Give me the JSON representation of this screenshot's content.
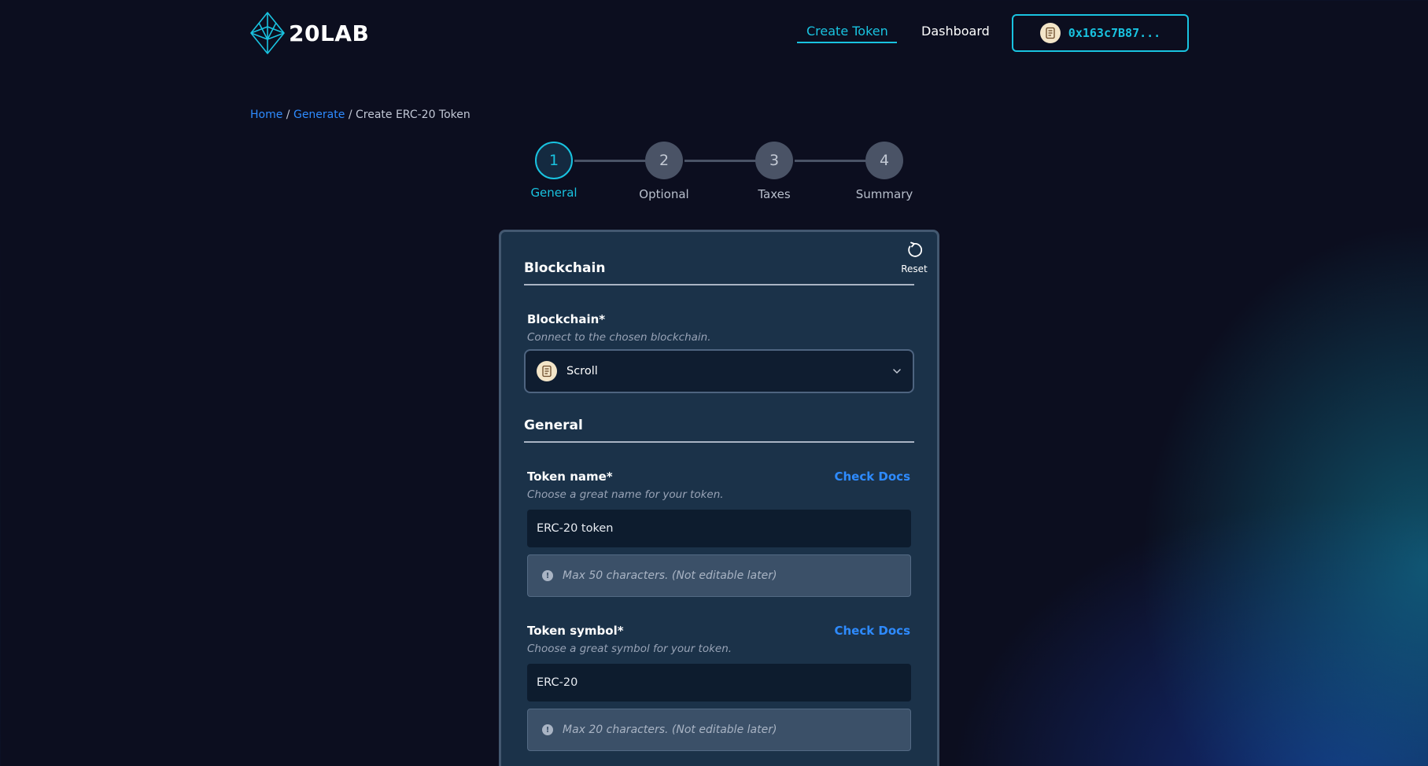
{
  "header": {
    "logo_text": "20LAB",
    "nav": {
      "create_token": "Create Token",
      "dashboard": "Dashboard"
    },
    "wallet_address": "0x163c7B87..."
  },
  "breadcrumb": {
    "home": "Home",
    "generate": "Generate",
    "current": "Create ERC-20 Token",
    "separator": "/"
  },
  "stepper": {
    "active_step": 1,
    "steps": [
      {
        "number": "1",
        "label": "General"
      },
      {
        "number": "2",
        "label": "Optional"
      },
      {
        "number": "3",
        "label": "Taxes"
      },
      {
        "number": "4",
        "label": "Summary"
      }
    ]
  },
  "form": {
    "reset_label": "Reset",
    "blockchain_section": {
      "title": "Blockchain",
      "label": "Blockchain*",
      "hint": "Connect to the chosen blockchain.",
      "selected_value": "Scroll"
    },
    "general_section": {
      "title": "General",
      "token_name": {
        "label": "Token name*",
        "hint": "Choose a great name for your token.",
        "docs_link": "Check Docs",
        "value": "ERC-20 token",
        "note": "Max 50 characters. (Not editable later)"
      },
      "token_symbol": {
        "label": "Token symbol*",
        "hint": "Choose a great symbol for your token.",
        "docs_link": "Check Docs",
        "value": "ERC-20",
        "note": "Max 20 characters. (Not editable later)"
      }
    }
  },
  "colors": {
    "accent": "#19c3e0",
    "link": "#2e8bff",
    "background": "#0c0e1f",
    "card": "#1b3249"
  }
}
